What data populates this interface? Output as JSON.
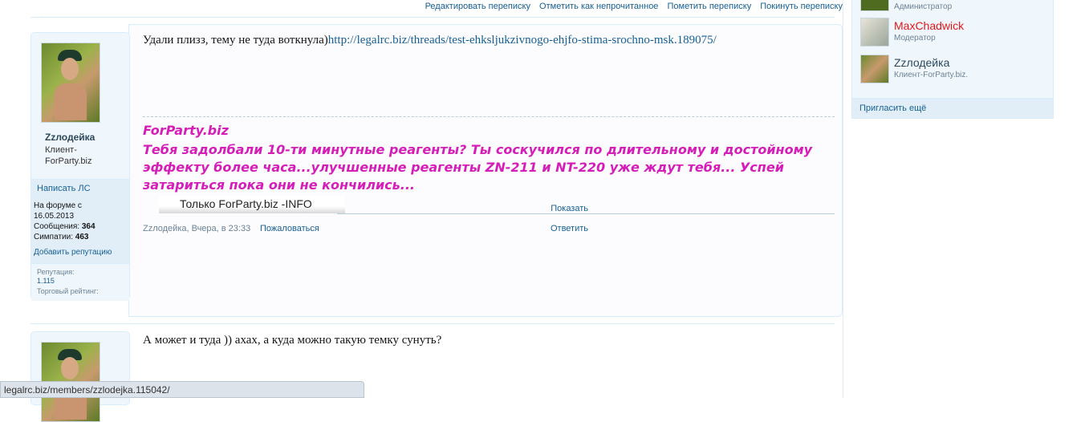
{
  "top_actions": [
    "Редактировать переписку",
    "Отметить как непрочитанное",
    "Пометить переписку",
    "Покинуть переписку"
  ],
  "post1": {
    "username": "Zzлодейка",
    "user_title": "Клиент-ForParty.biz",
    "pm_link": "Написать ЛС",
    "stats": {
      "joined_label": "На форуме с",
      "joined": "16.05.2013",
      "messages_label": "Сообщения:",
      "messages": "364",
      "likes_label": "Симпатии:",
      "likes": "463"
    },
    "add_rep": "Добавить репутацию",
    "rep_label": "Репутация:",
    "rep_value": "1.115",
    "trade_label": "Торговый рейтинг:",
    "message_text": "Удали плизз, тему не туда воткнула)",
    "message_link": "http://legalrc.biz/threads/test-ehksljukzivnogo-ehjfo-stima-srochno-msk.189075/",
    "signature_brand": "ForParty.biz",
    "signature_text": "Тебя задолбали 10-ти минутные реагенты? Ты соскучился по длительному и достойному эффекту более часа...улучшенные реагенты ZN-211 и NT-220 уже ждут тебя... Успей затариться пока они не кончились...",
    "info_banner": "Только ForParty.biz -INFO",
    "show_link": "Показать",
    "meta": "Zzлодейка, Вчера, в 23:33",
    "report": "Пожаловаться",
    "reply": "Ответить"
  },
  "post2": {
    "message_text": "А может и туда )) ахах, а куда можно такую темку сунуть?"
  },
  "sidebar": {
    "top_role": "Администратор",
    "users": [
      {
        "name": "MaxChadwick",
        "role": "Модератор",
        "color": "#e01818"
      },
      {
        "name": "Zzлодейка",
        "role": "Клиент-ForParty.biz.",
        "color": "#2b485c"
      }
    ],
    "invite": "Пригласить ещё"
  },
  "statusbar_url": "legalrc.biz/members/zzlodejka.115042/"
}
